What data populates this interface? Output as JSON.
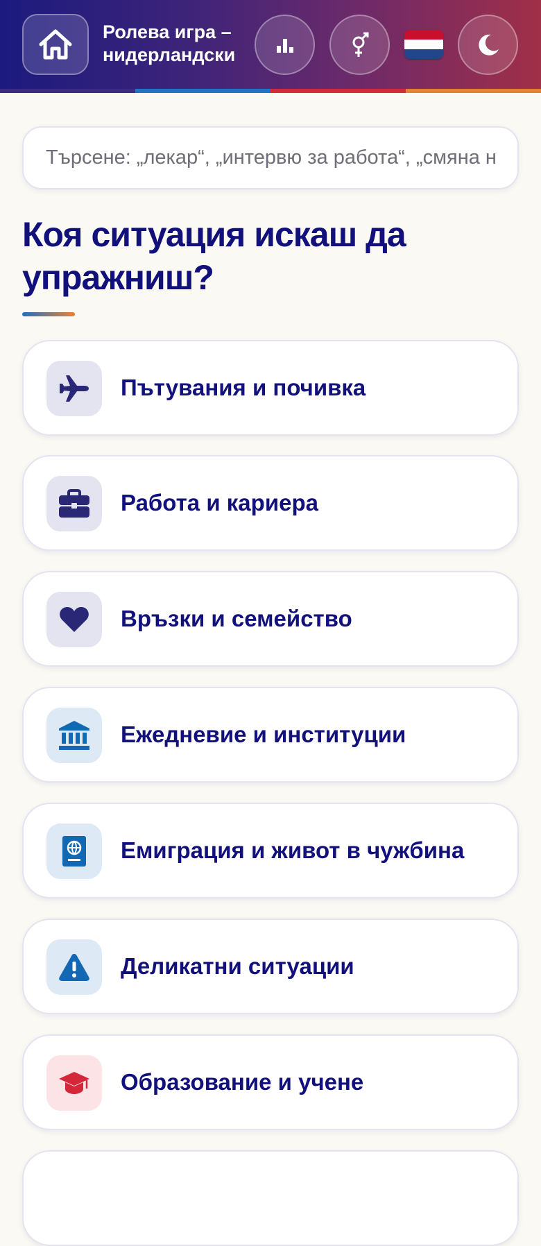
{
  "header": {
    "title_line1": "Ролева игра –",
    "title_line2": "нидерландски",
    "icons": [
      "home-icon",
      "stats-icon",
      "gender-icon",
      "netherlands-flag-icon",
      "moon-icon"
    ],
    "gradient_colors": [
      "#1c1a7e",
      "#6b2a6a",
      "#a02f48"
    ],
    "stripe_colors": [
      "#3b2a86",
      "#1e74c8",
      "#d42a3b",
      "#e9822f"
    ]
  },
  "search": {
    "placeholder": "Търсене: „лекар“, „интервю за работа“, „смяна на адрес“",
    "value": ""
  },
  "main": {
    "heading": "Коя ситуация искаш да упражниш?",
    "categories": [
      {
        "label": "Пътувания и почивка",
        "icon": "airplane-icon",
        "icon_color": "#2a2876",
        "icon_bg": "#e4e4f0"
      },
      {
        "label": "Работа и кариера",
        "icon": "briefcase-icon",
        "icon_color": "#2a2876",
        "icon_bg": "#e4e4f0"
      },
      {
        "label": "Връзки и семейство",
        "icon": "heart-icon",
        "icon_color": "#2a2876",
        "icon_bg": "#e4e4f0"
      },
      {
        "label": "Ежедневие и институции",
        "icon": "bank-building-icon",
        "icon_color": "#1368b3",
        "icon_bg": "#dde9f5"
      },
      {
        "label": "Емиграция и живот в чужбина",
        "icon": "passport-icon",
        "icon_color": "#1368b3",
        "icon_bg": "#dde9f5"
      },
      {
        "label": "Деликатни ситуации",
        "icon": "warning-icon",
        "icon_color": "#1368b3",
        "icon_bg": "#dde9f5"
      },
      {
        "label": "Образование и учене",
        "icon": "graduation-cap-icon",
        "icon_color": "#d4283a",
        "icon_bg": "#fbe3e6"
      }
    ]
  }
}
